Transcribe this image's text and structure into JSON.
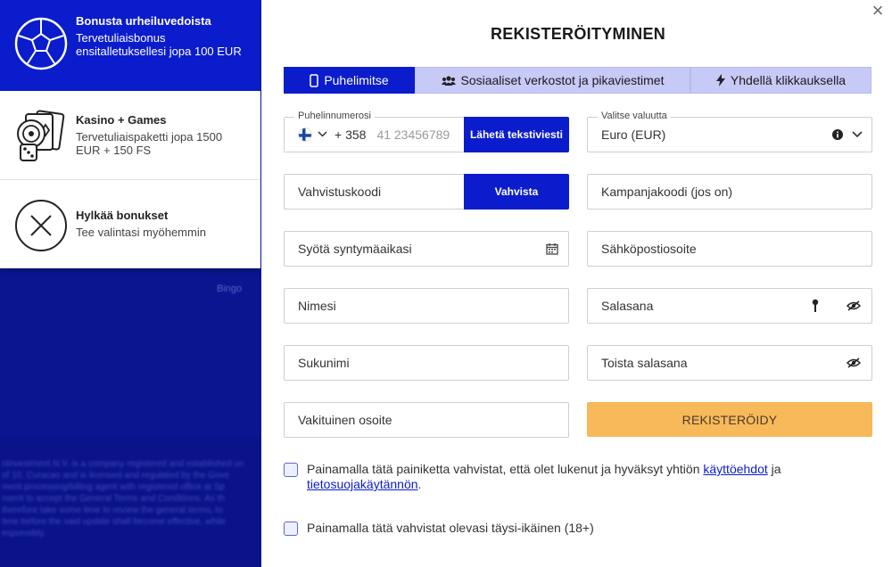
{
  "background": {
    "bingo_label": "Bingo",
    "footer_text": "nInvestment N.V. is a company registered and established un\nof 10, Curacao and is licensed and regulated by the Gove\nment processing/billing agent with registered office at Sp\nnsent to accept the General Terms and Conditions. As th\ntherefore take some time to review the general terms, to\ntime before the said update shall become effective, while\nesponsibly."
  },
  "bonuses": [
    {
      "title": "Bonusta urheiluvedoista",
      "subtitle": "Tervetuliaisbonus ensitalletuksellesi jopa 100 EUR",
      "icon": "soccer-ball-icon"
    },
    {
      "title": "Kasino + Games",
      "subtitle": "Tervetuliaispaketti jopa 1500 EUR + 150 FS",
      "icon": "casino-cards-dice-icon"
    },
    {
      "title": "Hylkää bonukset",
      "subtitle": "Tee valintasi myöhemmin",
      "icon": "x-circle-icon"
    }
  ],
  "modal": {
    "title": "REKISTERÖITYMINEN",
    "close_symbol": "×",
    "tabs": [
      {
        "label": "Puhelimitse",
        "icon": "phone-icon",
        "active": true
      },
      {
        "label": "Sosiaaliset verkostot ja pikaviestimet",
        "icon": "users-icon",
        "active": false
      },
      {
        "label": "Yhdellä klikkauksella",
        "icon": "bolt-icon",
        "active": false
      }
    ],
    "phone": {
      "label": "Puhelinnumerosi",
      "country_code": "+ 358",
      "placeholder": "41 23456789",
      "send_button": "Lähetä tekstiviesti"
    },
    "currency": {
      "label": "Valitse valuutta",
      "value": "Euro (EUR)"
    },
    "verification_code": {
      "placeholder": "Vahvistuskoodi",
      "button": "Vahvista"
    },
    "promo_code": "Kampanjakoodi (jos on)",
    "birthdate": "Syötä syntymäaikasi",
    "email": "Sähköpostiosoite",
    "first_name": "Nimesi",
    "password": "Salasana",
    "last_name": "Sukunimi",
    "repeat_password": "Toista salasana",
    "address": "Vakituinen osoite",
    "register_button": "REKISTERÖIDY",
    "terms": {
      "text_before": "Painamalla tätä painiketta vahvistat, että olet lukenut ja hyväksyt yhtiön ",
      "link1": "käyttöehdot",
      "text_mid": " ja ",
      "link2": "tietosuojakäytännön",
      "text_after": "."
    },
    "age_confirm": "Painamalla tätä vahvistat olevasi täysi-ikäinen (18+)"
  },
  "colors": {
    "primary_blue": "#0b1ccc",
    "tab_inactive": "#c7c9f7",
    "register_orange": "#f7b95a",
    "background_navy": "#0b139a"
  }
}
